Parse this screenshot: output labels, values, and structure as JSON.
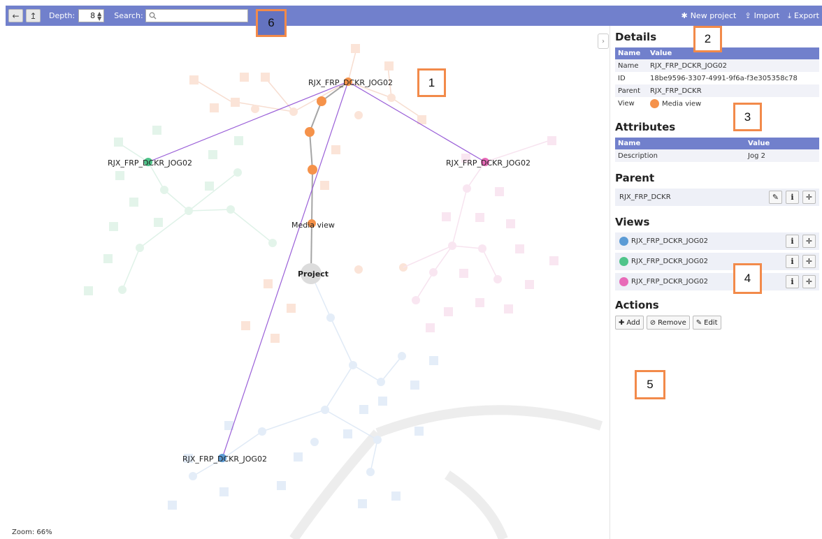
{
  "toolbar": {
    "depth_label": "Depth:",
    "depth_value": "8",
    "search_label": "Search:",
    "search_value": "",
    "new_project": "New project",
    "import": "Import",
    "export": "Export"
  },
  "annotations": [
    "1",
    "2",
    "3",
    "4",
    "5",
    "6"
  ],
  "graph": {
    "labels": {
      "top": "RJX_FRP_DCKR_JOG02",
      "left": "RJX_FRP_DCKR_JOG02",
      "right": "RJX_FRP_DCKR_JOG02",
      "bottom": "RJX_FRP_DCKR_JOG02",
      "media_view": "Media view",
      "project": "Project"
    },
    "zoom": "Zoom: 66%"
  },
  "details": {
    "title": "Details",
    "col_name": "Name",
    "col_value": "Value",
    "rows": [
      {
        "k": "Name",
        "v": "RJX_FRP_DCKR_JOG02"
      },
      {
        "k": "ID",
        "v": "18be9596-3307-4991-9f6a-f3e305358c78"
      },
      {
        "k": "Parent",
        "v": "RJX_FRP_DCKR"
      },
      {
        "k": "View",
        "v": "Media view"
      }
    ]
  },
  "attributes": {
    "title": "Attributes",
    "col_name": "Name",
    "col_value": "Value",
    "rows": [
      {
        "k": "Description",
        "v": "Jog 2"
      }
    ]
  },
  "parent": {
    "title": "Parent",
    "name": "RJX_FRP_DCKR"
  },
  "views": {
    "title": "Views",
    "items": [
      {
        "name": "RJX_FRP_DCKR_JOG02",
        "color": "#5b9bd5"
      },
      {
        "name": "RJX_FRP_DCKR_JOG02",
        "color": "#4fc48a"
      },
      {
        "name": "RJX_FRP_DCKR_JOG02",
        "color": "#e86ab8"
      }
    ]
  },
  "actions": {
    "title": "Actions",
    "add": "Add",
    "remove": "Remove",
    "edit": "Edit"
  },
  "colors": {
    "accent": "#7180cc",
    "orange": "#f5924a",
    "annotation_border": "#f28a4a"
  }
}
